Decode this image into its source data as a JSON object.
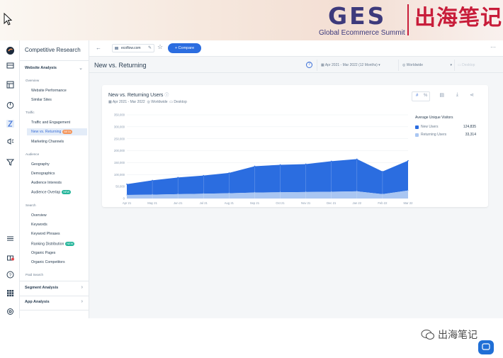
{
  "banner": {
    "ges": "GES",
    "subtitle": "Global Ecommerce Summit",
    "cn_title": "出海笔记"
  },
  "nav": {
    "title": "Competitive Research",
    "section_website": "Website Analysis",
    "group_overview": "Overview",
    "item_website_performance": "Website Performance",
    "item_similar_sites": "Similar Sites",
    "group_traffic": "Traffic",
    "item_traffic_engagement": "Traffic and Engagement",
    "item_new_returning": "New vs. Returning",
    "badge_new_returning": "BETA",
    "item_marketing_channels": "Marketing Channels",
    "group_audience": "Audience",
    "item_geography": "Geography",
    "item_demographics": "Demographics",
    "item_audience_interests": "Audience Interests",
    "item_audience_overlap": "Audience Overlap",
    "badge_audience_overlap": "NEW",
    "group_search": "Search",
    "item_overview": "Overview",
    "item_keywords": "Keywords",
    "item_keyword_phrases": "Keyword Phrases",
    "item_ranking_distribution": "Ranking Distribution",
    "badge_ranking": "NEW",
    "item_organic_pages": "Organic Pages",
    "item_organic_competitors": "Organic Competitors",
    "group_paid_search": "Paid Search",
    "section_segment": "Segment Analysis",
    "section_app": "App Analysis"
  },
  "topbar": {
    "site": "ecoflow.com",
    "compare_label": "+ Compare",
    "more": "···"
  },
  "header": {
    "title": "New vs. Returning",
    "help": "?",
    "date_range": "Apr 2021 - Mar 2022 (12 Months)",
    "region": "Worldwide",
    "device": "Desktop"
  },
  "card": {
    "title": "New vs. Returning Users",
    "date": "Apr 2021 - Mar 2022",
    "region": "Worldwide",
    "device": "Desktop"
  },
  "colors": {
    "new_users": "#2b6de0",
    "returning_users": "#a9c6f2",
    "accent": "#2b6de0"
  },
  "chart_data": {
    "type": "area",
    "stacked": true,
    "categories": [
      "Apr 21",
      "May 21",
      "Jun 21",
      "Jul 21",
      "Aug 21",
      "Sep 21",
      "Oct 21",
      "Nov 21",
      "Dec 21",
      "Jan 22",
      "Feb 22",
      "Mar 22"
    ],
    "series": [
      {
        "name": "New Users",
        "values": [
          45000,
          60000,
          70000,
          76000,
          85000,
          110000,
          115000,
          117000,
          128000,
          135000,
          95000,
          124835
        ]
      },
      {
        "name": "Returning Users",
        "values": [
          15000,
          16000,
          18000,
          20000,
          22000,
          25000,
          26000,
          27000,
          28000,
          30000,
          18000,
          33314
        ]
      }
    ],
    "y_ticks": [
      "350,000",
      "300,000",
      "250,000",
      "200,000",
      "150,000",
      "100,000",
      "50,000",
      "0"
    ],
    "ylim": [
      0,
      350000
    ],
    "legend_title": "Average Unique Visitors",
    "legend": [
      {
        "name": "New Users",
        "value": "124,835"
      },
      {
        "name": "Returning Users",
        "value": "33,314"
      }
    ],
    "legend_position": "right",
    "grid": true
  },
  "watermark": "出海笔记"
}
